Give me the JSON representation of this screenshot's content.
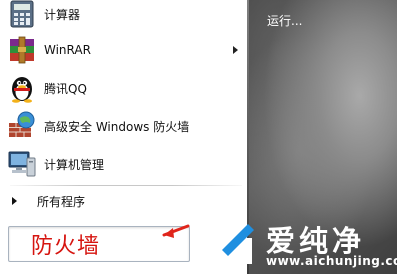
{
  "start_menu": {
    "programs": [
      {
        "label": "计算器",
        "icon": "calculator-icon",
        "has_submenu": false
      },
      {
        "label": "WinRAR",
        "icon": "winrar-icon",
        "has_submenu": true
      },
      {
        "label": "腾讯QQ",
        "icon": "qq-penguin-icon",
        "has_submenu": false
      },
      {
        "label": "高级安全 Windows 防火墙",
        "icon": "firewall-icon",
        "has_submenu": false
      },
      {
        "label": "计算机管理",
        "icon": "computer-management-icon",
        "has_submenu": false
      }
    ],
    "all_programs_label": "所有程序",
    "search": {
      "value": "防火墙"
    },
    "right_pane": {
      "run_label": "运行..."
    }
  },
  "watermark": {
    "title": "爱纯净",
    "url": "www.aichunjing.com"
  },
  "colors": {
    "search_text": "#d6140f",
    "arrow": "#e0251b",
    "left_pane_bg": "#ffffff"
  }
}
